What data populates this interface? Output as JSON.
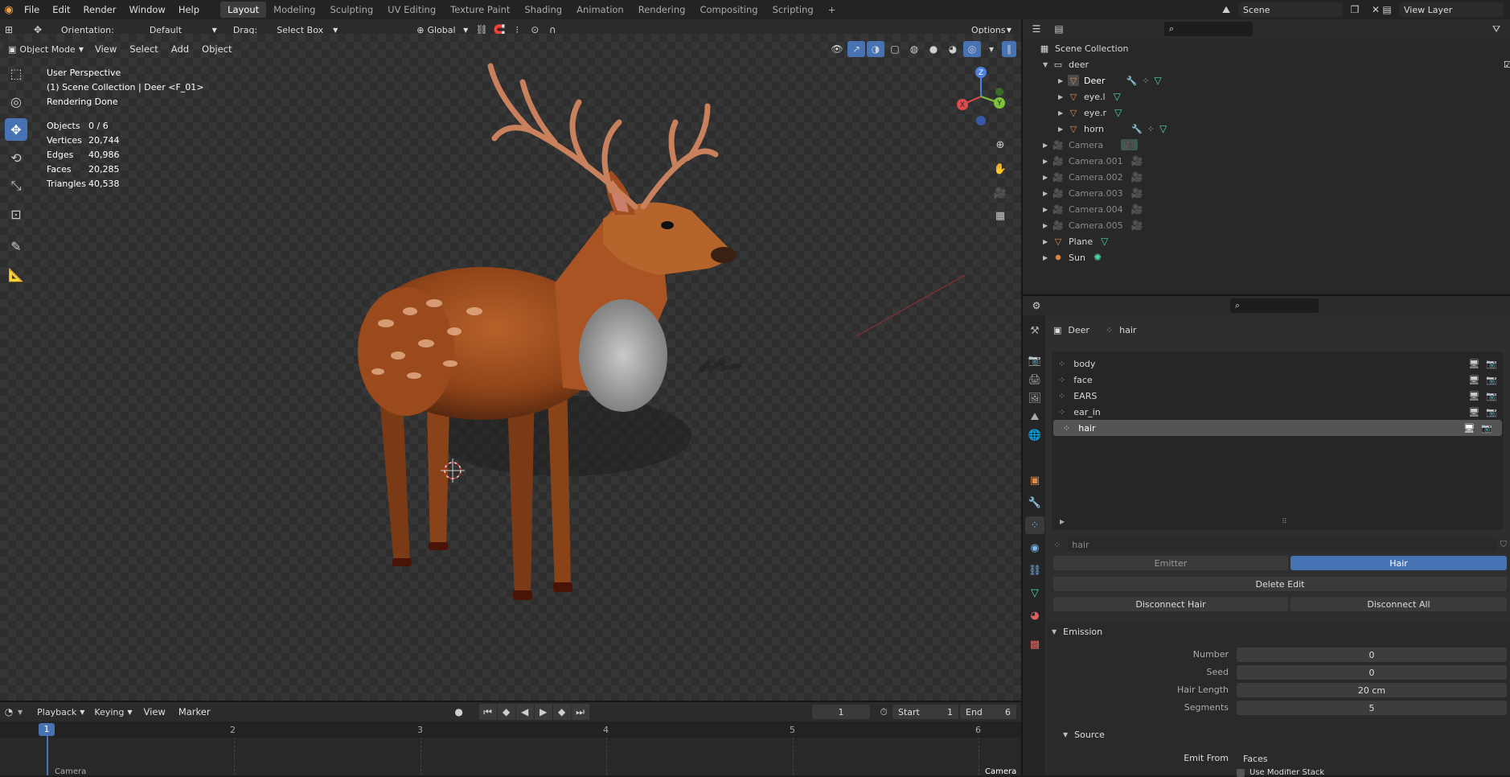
{
  "menus": [
    "File",
    "Edit",
    "Render",
    "Window",
    "Help"
  ],
  "workspaces": [
    "Layout",
    "Modeling",
    "Sculpting",
    "UV Editing",
    "Texture Paint",
    "Shading",
    "Animation",
    "Rendering",
    "Compositing",
    "Scripting"
  ],
  "workspace_add": "+",
  "scene": {
    "label": "Scene",
    "view_layer": "View Layer"
  },
  "tool_header": {
    "orientation_label": "Orientation:",
    "orientation_value": "Default",
    "drag_label": "Drag:",
    "drag_value": "Select Box",
    "transform_space": "Global",
    "options": "Options"
  },
  "viewport_header": {
    "mode": "Object Mode",
    "menus": [
      "View",
      "Select",
      "Add",
      "Object"
    ]
  },
  "overlay": {
    "line1": "User Perspective",
    "line2": "(1) Scene Collection | Deer <F_01>",
    "line3": "Rendering Done",
    "stats": [
      {
        "label": "Objects",
        "value": "0 / 6"
      },
      {
        "label": "Vertices",
        "value": "20,744"
      },
      {
        "label": "Edges",
        "value": "40,986"
      },
      {
        "label": "Faces",
        "value": "20,285"
      },
      {
        "label": "Triangles",
        "value": "40,538"
      }
    ]
  },
  "gizmo": {
    "z": "Z",
    "x": "X",
    "y": "Y"
  },
  "outliner": {
    "root": "Scene Collection",
    "collection": "deer",
    "items": [
      {
        "name": "Deer",
        "level": 1,
        "type": "mesh"
      },
      {
        "name": "eye.l",
        "level": 1,
        "type": "mesh"
      },
      {
        "name": "eye.r",
        "level": 1,
        "type": "mesh"
      },
      {
        "name": "horn",
        "level": 1,
        "type": "mesh"
      },
      {
        "name": "Camera",
        "level": 0,
        "type": "camera"
      },
      {
        "name": "Camera.001",
        "level": 0,
        "type": "camera"
      },
      {
        "name": "Camera.002",
        "level": 0,
        "type": "camera"
      },
      {
        "name": "Camera.003",
        "level": 0,
        "type": "camera"
      },
      {
        "name": "Camera.004",
        "level": 0,
        "type": "camera"
      },
      {
        "name": "Camera.005",
        "level": 0,
        "type": "camera"
      },
      {
        "name": "Plane",
        "level": 0,
        "type": "mesh"
      },
      {
        "name": "Sun",
        "level": 0,
        "type": "light"
      }
    ]
  },
  "properties": {
    "breadcrumb": {
      "object": "Deer",
      "system": "hair"
    },
    "particle_systems": [
      "body",
      "face",
      "EARS",
      "ear_in",
      "hair"
    ],
    "selected_system": "hair",
    "settings_name": "hair",
    "type_buttons": {
      "emitter": "Emitter",
      "hair": "Hair"
    },
    "delete_edit": "Delete Edit",
    "disconnect_hair": "Disconnect Hair",
    "disconnect_all": "Disconnect All",
    "emission": {
      "title": "Emission",
      "fields": [
        {
          "label": "Number",
          "value": "0"
        },
        {
          "label": "Seed",
          "value": "0"
        },
        {
          "label": "Hair Length",
          "value": "20 cm"
        },
        {
          "label": "Segments",
          "value": "5"
        }
      ]
    },
    "source": {
      "title": "Source",
      "emit_from_label": "Emit From",
      "emit_from_value": "Faces",
      "modifier_stack": "Use Modifier Stack"
    }
  },
  "timeline": {
    "menus": [
      "Playback",
      "Keying",
      "View",
      "Marker"
    ],
    "current_frame": "1",
    "start_label": "Start",
    "start": "1",
    "end_label": "End",
    "end": "6",
    "ticks": [
      "1",
      "2",
      "3",
      "4",
      "5",
      "6"
    ],
    "marker_left": "Camera",
    "marker_right": "Camera"
  },
  "colors": {
    "accent": "#4772b3",
    "selected_row": "#545454",
    "hair_active": "#4772b3",
    "mesh_icon": "#e08b4b",
    "data_icon": "#4dd9a0"
  }
}
